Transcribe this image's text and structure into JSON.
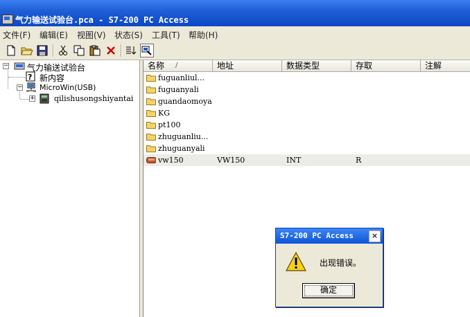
{
  "window": {
    "title": "气力输送试验台.pca - S7-200 PC Access"
  },
  "menu": [
    "文件(F)",
    "编辑(E)",
    "视图(V)",
    "状态(S)",
    "工具(T)",
    "帮助(H)"
  ],
  "toolbar": {
    "icons": [
      "new-file-icon",
      "open-folder-icon",
      "save-icon",
      "cut-icon",
      "copy-icon",
      "paste-icon",
      "delete-icon",
      "sort-icon",
      "test-client-icon"
    ]
  },
  "tree": {
    "root": "气力输送试验台",
    "new_item": "新内容",
    "plc": "MicroWin(USB)",
    "station": "qilishusongshiyantai"
  },
  "list": {
    "columns": [
      "名称",
      "地址",
      "数据类型",
      "存取",
      "注解"
    ],
    "sort_indicator": "/",
    "rows": [
      {
        "name": "fuguanliul...",
        "kind": "folder"
      },
      {
        "name": "fuguanyali",
        "kind": "folder"
      },
      {
        "name": "guandaomoya",
        "kind": "folder"
      },
      {
        "name": "KG",
        "kind": "folder"
      },
      {
        "name": "pt100",
        "kind": "folder"
      },
      {
        "name": "zhuguanliu...",
        "kind": "folder"
      },
      {
        "name": "zhuguanyali",
        "kind": "folder"
      },
      {
        "name": "vw150",
        "kind": "item",
        "address": "VW150",
        "type": "INT",
        "access": "R"
      }
    ]
  },
  "dialog": {
    "title": "S7-200 PC Access",
    "message": "出现错误。",
    "ok": "确定",
    "close": "×"
  }
}
